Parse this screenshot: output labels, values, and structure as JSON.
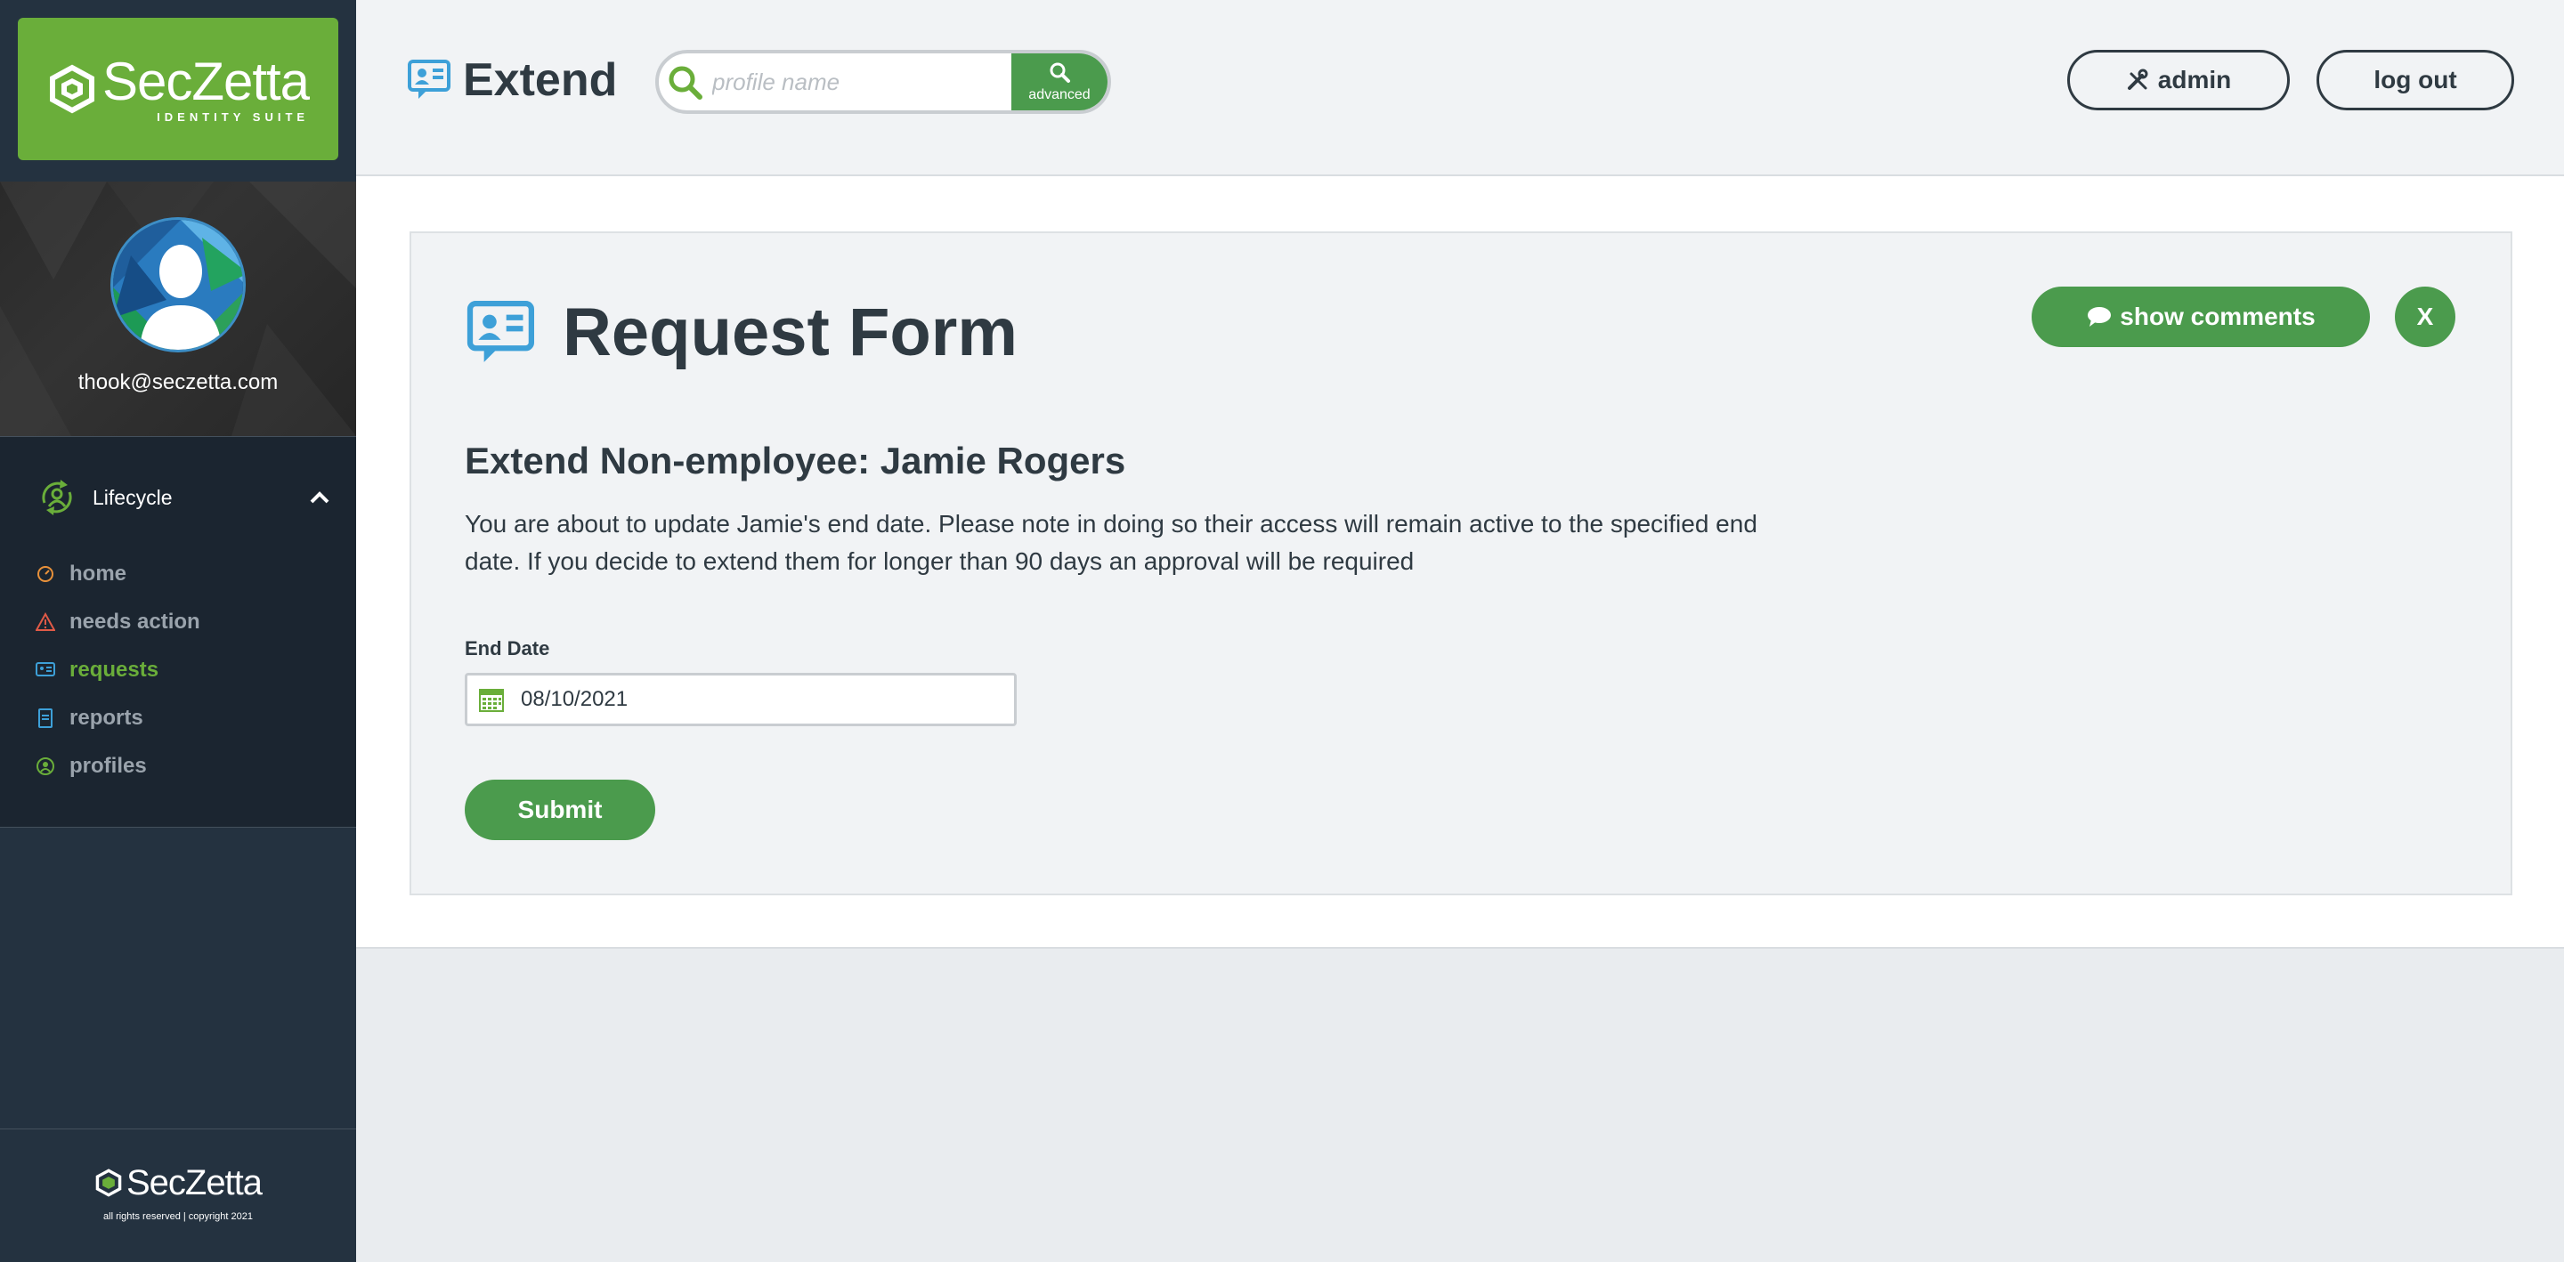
{
  "brand": {
    "name": "SecZetta",
    "tagline": "IDENTITY SUITE",
    "green": "#6aae3a",
    "button_green": "#4b9b4d"
  },
  "sidebar": {
    "user_email": "thook@seczetta.com",
    "section": {
      "label": "Lifecycle",
      "icon": "lifecycle-icon",
      "expanded": true
    },
    "items": [
      {
        "label": "home",
        "icon": "dashboard-icon",
        "active": false
      },
      {
        "label": "needs action",
        "icon": "warning-icon",
        "active": false
      },
      {
        "label": "requests",
        "icon": "request-icon",
        "active": true
      },
      {
        "label": "reports",
        "icon": "report-icon",
        "active": false
      },
      {
        "label": "profiles",
        "icon": "profile-icon",
        "active": false
      }
    ],
    "footer_copyright": "all rights reserved | copyright 2021"
  },
  "header": {
    "title": "Extend",
    "search": {
      "placeholder": "profile name",
      "value": "",
      "advanced_label": "advanced"
    },
    "admin_label": "admin",
    "logout_label": "log out"
  },
  "form": {
    "title": "Request Form",
    "show_comments_label": "show comments",
    "close_label": "X",
    "subheading": "Extend Non-employee: Jamie Rogers",
    "description": "You are about to update Jamie's end date. Please note in doing so their access will remain active to the specified end date. If you decide to extend them for longer than 90 days an approval will be required",
    "end_date_label": "End Date",
    "end_date_value": "08/10/2021",
    "submit_label": "Submit"
  }
}
